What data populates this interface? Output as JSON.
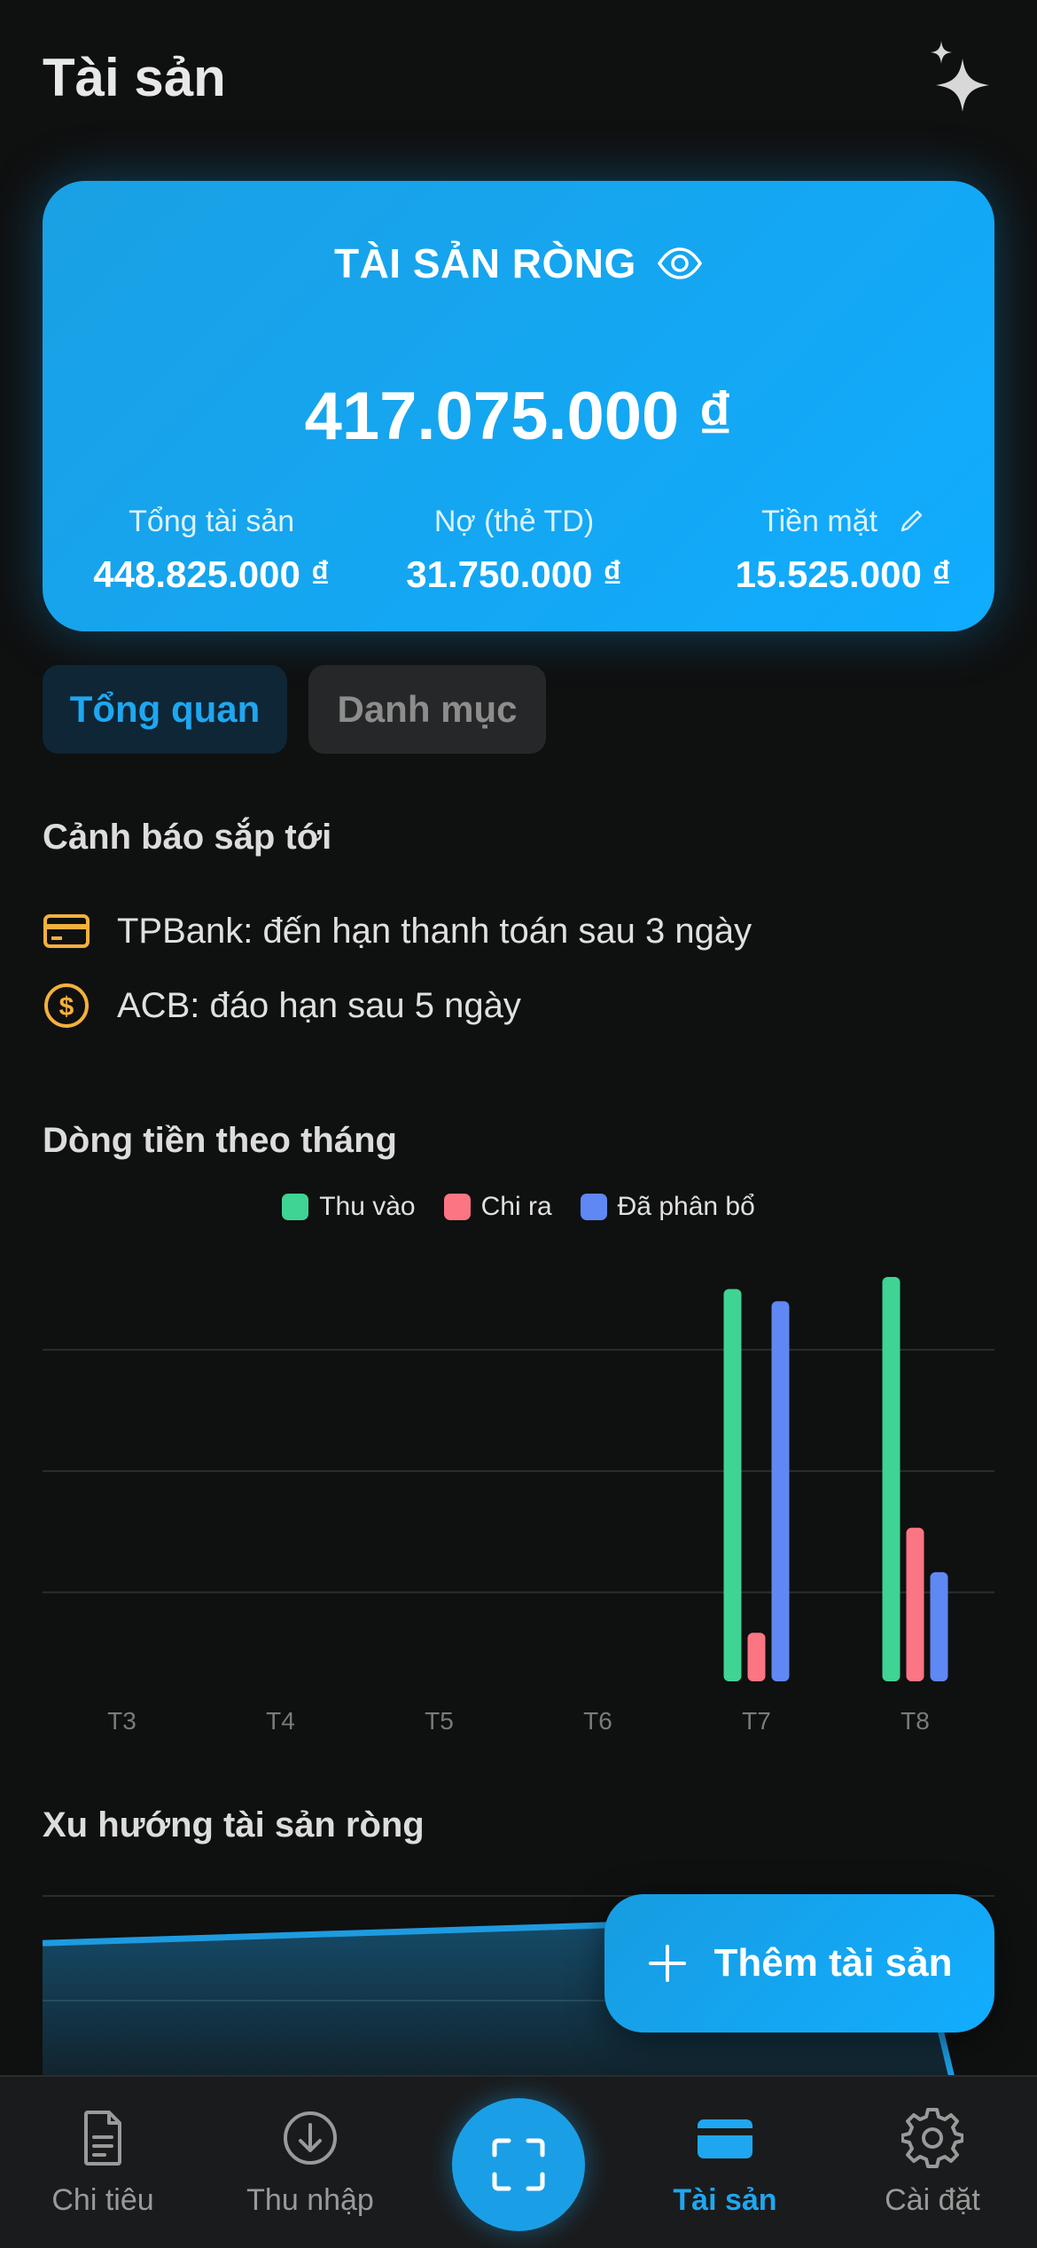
{
  "header": {
    "title": "Tài sản"
  },
  "summary": {
    "title": "TÀI SẢN RÒNG",
    "net_worth": "417.075.000 ₫",
    "total_assets_label": "Tổng tài sản",
    "total_assets": "448.825.000 ₫",
    "debt_label": "Nợ (thẻ TD)",
    "debt": "31.750.000 ₫",
    "cash_label": "Tiền mặt",
    "cash": "15.525.000 ₫"
  },
  "tabs": [
    {
      "label": "Tổng quan",
      "active": true
    },
    {
      "label": "Danh mục",
      "active": false
    }
  ],
  "alerts": {
    "title": "Cảnh báo sắp tới",
    "items": [
      {
        "icon": "credit-card-icon",
        "text": "TPBank: đến hạn thanh toán sau 3 ngày"
      },
      {
        "icon": "dollar-coin-icon",
        "text": "ACB: đáo hạn sau 5 ngày"
      }
    ]
  },
  "cashflow": {
    "title": "Dòng tiền theo tháng"
  },
  "chart_data": [
    {
      "type": "bar",
      "title": "Dòng tiền theo tháng",
      "categories": [
        "T3",
        "T4",
        "T5",
        "T6",
        "T7",
        "T8"
      ],
      "series": [
        {
          "name": "Thu vào",
          "color": "#3fd493",
          "values": [
            0,
            0,
            0,
            0,
            97,
            100
          ]
        },
        {
          "name": "Chi ra",
          "color": "#fc7583",
          "values": [
            0,
            0,
            0,
            0,
            12,
            38
          ]
        },
        {
          "name": "Đã phân bổ",
          "color": "#5f88f4",
          "values": [
            0,
            0,
            0,
            0,
            94,
            27
          ]
        }
      ],
      "ylim": [
        0,
        100
      ],
      "grid": true,
      "legend": "top-center"
    },
    {
      "type": "area",
      "title": "Xu hướng tài sản ròng",
      "color": "#1e9be0",
      "x": [
        0,
        1,
        2,
        3
      ],
      "values": [
        82,
        88,
        94,
        20
      ],
      "ylim": [
        0,
        100
      ]
    }
  ],
  "trend": {
    "title": "Xu hướng tài sản ròng"
  },
  "fab": {
    "label": "Thêm tài sản"
  },
  "nav": [
    {
      "label": "Chi tiêu",
      "icon": "document-icon",
      "active": false
    },
    {
      "label": "Thu nhập",
      "icon": "download-circle-icon",
      "active": false
    },
    {
      "label": "",
      "icon": "scan-icon",
      "active": false
    },
    {
      "label": "Tài sản",
      "icon": "wallet-card-icon",
      "active": true
    },
    {
      "label": "Cài đặt",
      "icon": "gear-icon",
      "active": false
    }
  ]
}
